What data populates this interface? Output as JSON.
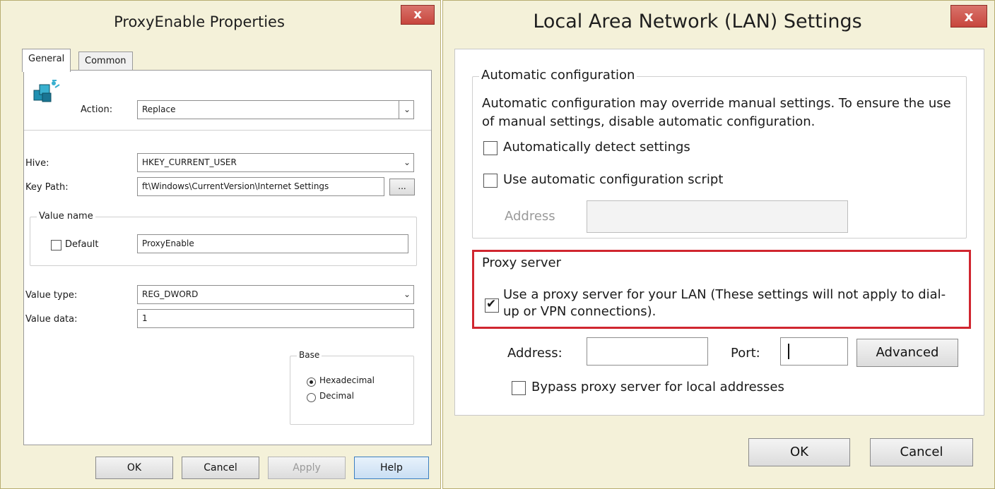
{
  "left_dialog": {
    "title": "ProxyEnable Properties",
    "close_glyph": "x",
    "tabs": [
      "General",
      "Common"
    ],
    "icon": "registry-cubes-icon",
    "action_label": "Action:",
    "action_value": "Replace",
    "hive_label": "Hive:",
    "hive_value": "HKEY_CURRENT_USER",
    "key_path_label": "Key Path:",
    "key_path_value": "ft\\Windows\\CurrentVersion\\Internet Settings",
    "browse_label": "...",
    "value_name_group": "Value name",
    "default_label": "Default",
    "default_checked": false,
    "value_name_value": "ProxyEnable",
    "value_type_label": "Value type:",
    "value_type_value": "REG_DWORD",
    "value_data_label": "Value data:",
    "value_data_value": "1",
    "base_group": "Base",
    "base_options": [
      "Hexadecimal",
      "Decimal"
    ],
    "base_selected": "Hexadecimal",
    "buttons": {
      "ok": "OK",
      "cancel": "Cancel",
      "apply": "Apply",
      "help": "Help"
    }
  },
  "right_dialog": {
    "title": "Local Area Network (LAN) Settings",
    "close_glyph": "x",
    "auto_group": "Automatic configuration",
    "auto_description": "Automatic configuration may override manual settings.  To ensure the use of manual settings, disable automatic configuration.",
    "auto_detect_label": "Automatically detect settings",
    "auto_detect_checked": false,
    "auto_script_label": "Use automatic configuration script",
    "auto_script_checked": false,
    "auto_address_label": "Address",
    "auto_address_value": "",
    "proxy_group": "Proxy server",
    "use_proxy_label": "Use a proxy server for your LAN (These settings will not apply to dial-up or VPN connections).",
    "use_proxy_checked": true,
    "check_glyph": "✔",
    "proxy_address_label": "Address:",
    "proxy_address_value": "",
    "port_label": "Port:",
    "port_value": "",
    "advanced_label": "Advanced",
    "bypass_label": "Bypass proxy server for local addresses",
    "bypass_checked": false,
    "buttons": {
      "ok": "OK",
      "cancel": "Cancel"
    },
    "highlight_color": "#d0262f"
  }
}
